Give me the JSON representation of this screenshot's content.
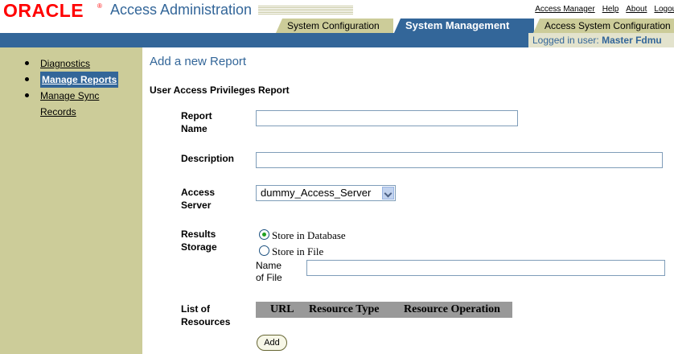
{
  "header": {
    "logo": "ORACLE",
    "logo_reg": "®",
    "app_title": "Access Administration",
    "global_links": [
      "Access Manager",
      "Help",
      "About",
      "Logout"
    ],
    "tabs": [
      {
        "label": "System Configuration",
        "active": false
      },
      {
        "label": "System Management",
        "active": true
      },
      {
        "label": "Access System Configuration",
        "active": false
      }
    ],
    "logged_in_prefix": "Logged in user:",
    "logged_in_user": "Master Fdmu"
  },
  "sidebar": {
    "items": [
      {
        "label": "Diagnostics",
        "active": false
      },
      {
        "label": "Manage Reports",
        "active": true
      },
      {
        "label": "Manage Sync",
        "label2": "Records",
        "active": false
      }
    ]
  },
  "main": {
    "page_title": "Add a new Report",
    "section_title": "User Access Privileges Report",
    "report_name": {
      "label1": "Report",
      "label2": "Name",
      "value": ""
    },
    "description": {
      "label": "Description",
      "value": ""
    },
    "access_server": {
      "label1": "Access",
      "label2": "Server",
      "selected": "dummy_Access_Server"
    },
    "results_storage": {
      "label1": "Results",
      "label2": "Storage",
      "options": [
        {
          "label": "Store in Database",
          "checked": true
        },
        {
          "label": "Store in File",
          "checked": false
        }
      ],
      "file_name_label1": "Name",
      "file_name_label2": "of File",
      "file_name_value": ""
    },
    "resources": {
      "label1": "List of",
      "label2": "Resources",
      "columns": [
        "URL",
        "Resource Type",
        "Resource Operation"
      ]
    },
    "add_button": "Add"
  },
  "colors": {
    "brand_red": "#ff0000",
    "accent_blue": "#336699",
    "tan": "#cccc99"
  }
}
